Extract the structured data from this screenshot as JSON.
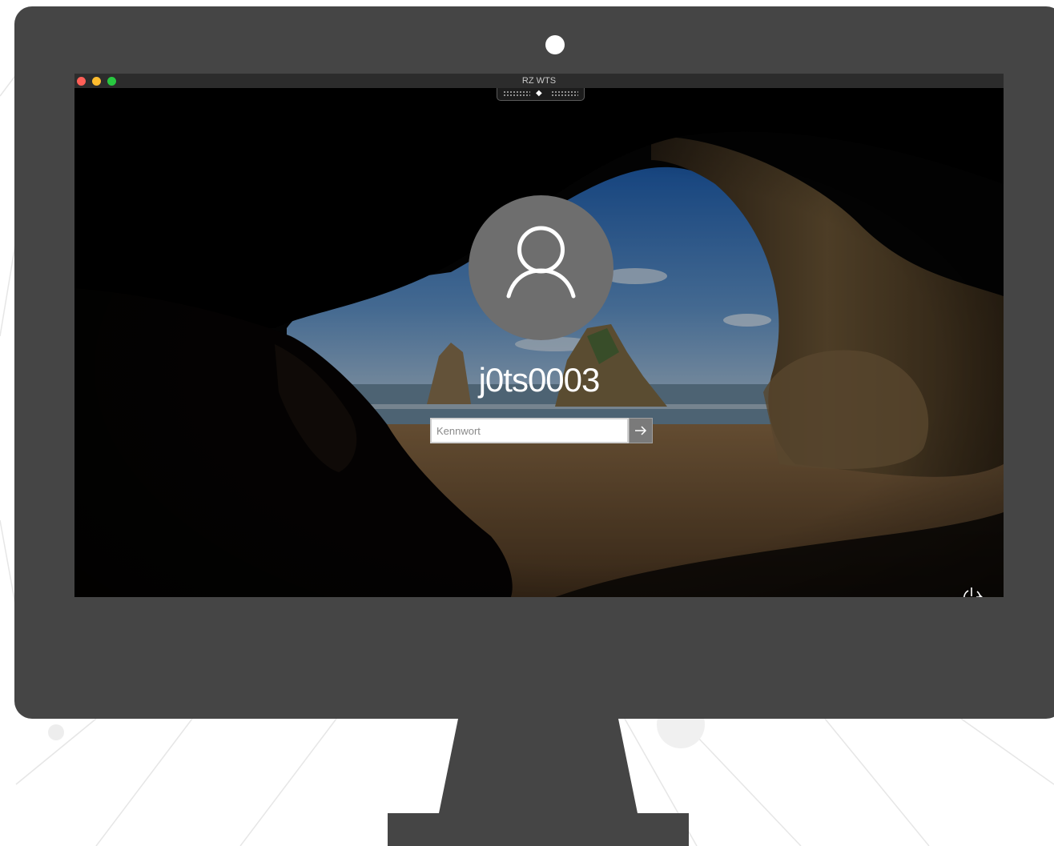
{
  "window": {
    "title": "RZ WTS"
  },
  "login": {
    "username": "j0ts0003",
    "password_placeholder": "Kennwort",
    "submit_icon": "arrow-right-icon",
    "avatar_icon": "user-icon",
    "power_icon": "power-options-icon"
  },
  "colors": {
    "monitor": "#454545",
    "avatar": "#6e6e6e",
    "traffic_close": "#ff5f57",
    "traffic_min": "#febc2e",
    "traffic_max": "#28c840"
  }
}
